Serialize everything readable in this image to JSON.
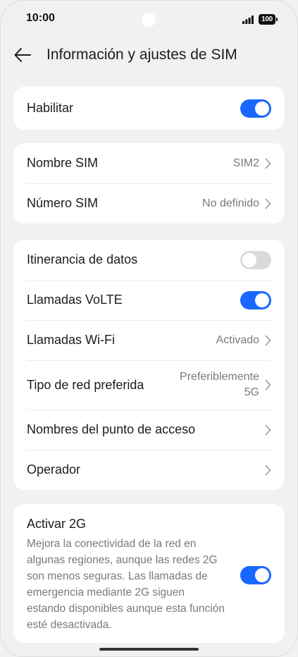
{
  "status_bar": {
    "time": "10:00",
    "battery": "100"
  },
  "header": {
    "title": "Información y ajustes de SIM"
  },
  "card_enable": {
    "label": "Habilitar",
    "enabled": true
  },
  "card_sim": {
    "rows": [
      {
        "label": "Nombre SIM",
        "value": "SIM2"
      },
      {
        "label": "Número SIM",
        "value": "No definido"
      }
    ]
  },
  "card_network": {
    "roaming": {
      "label": "Itinerancia de datos",
      "enabled": false
    },
    "volte": {
      "label": "Llamadas VoLTE",
      "enabled": true
    },
    "wifi_calls": {
      "label": "Llamadas Wi-Fi",
      "value": "Activado"
    },
    "network_type": {
      "label": "Tipo de red preferida",
      "value": "Preferiblemente 5G"
    },
    "apn": {
      "label": "Nombres del punto de acceso"
    },
    "operator": {
      "label": "Operador"
    }
  },
  "card_2g": {
    "title": "Activar 2G",
    "description": "Mejora la conectividad de la red en algunas regiones, aunque las redes 2G son menos seguras. Las llamadas de emergencia mediante 2G siguen estando disponibles aunque esta función esté desactivada.",
    "enabled": true
  },
  "colors": {
    "accent": "#1967ff",
    "background": "#f1f1f1",
    "card": "#ffffff",
    "secondary_text": "#7a7a7a"
  }
}
